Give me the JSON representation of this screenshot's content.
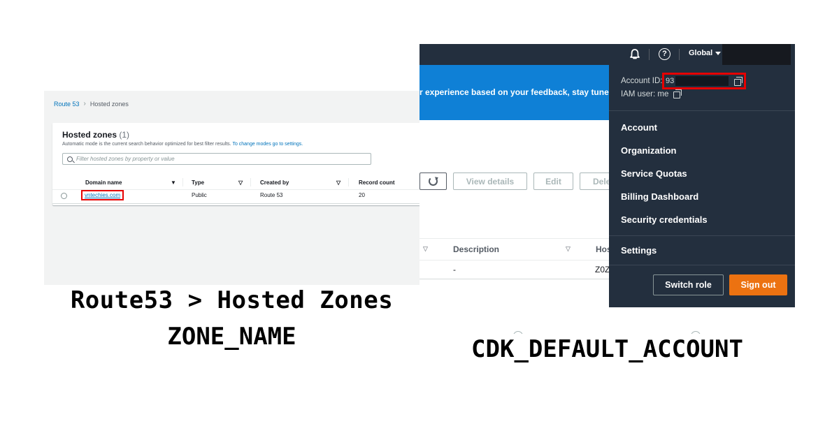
{
  "route53": {
    "breadcrumb": [
      "Route 53",
      "Hosted zones"
    ],
    "card": {
      "title": "Hosted zones",
      "count": "(1)",
      "description": "Automatic mode is the current search behavior optimized for best filter results.",
      "description_link": "To change modes go to settings.",
      "search_placeholder": "Filter hosted zones by property or value"
    },
    "columns": [
      "Domain name",
      "Type",
      "Created by",
      "Record count"
    ],
    "rows": [
      {
        "domain": "vntechies.com",
        "type": "Public",
        "created_by": "Route 53",
        "record_count": "20"
      }
    ],
    "caption_line1": "Route53 > Hosted Zones",
    "caption_line2": "ZONE_NAME"
  },
  "console": {
    "region": "Global",
    "banner_text": "r experience based on your feedback, stay tuned! If",
    "toolbar": {
      "view_details": "View details",
      "edit": "Edit",
      "delete_partial": "Dele"
    },
    "table": {
      "description_header": "Description",
      "hosted_partial_header": "Hos",
      "description_value": "-",
      "hosted_partial_value": "Z0Z"
    },
    "menu": {
      "account_id_label": "Account ID:",
      "account_id_value": "93",
      "iam_user": "IAM user: me",
      "items": [
        "Account",
        "Organization",
        "Service Quotas",
        "Billing Dashboard",
        "Security credentials"
      ],
      "settings": "Settings",
      "switch_role": "Switch role",
      "sign_out": "Sign out"
    },
    "colors": {
      "navbar": "#232f3e",
      "banner": "#0f80d6",
      "sign_out": "#ec7211",
      "highlight": "#e60000"
    },
    "caption": "CDK_DEFAULT_ACCOUNT"
  }
}
